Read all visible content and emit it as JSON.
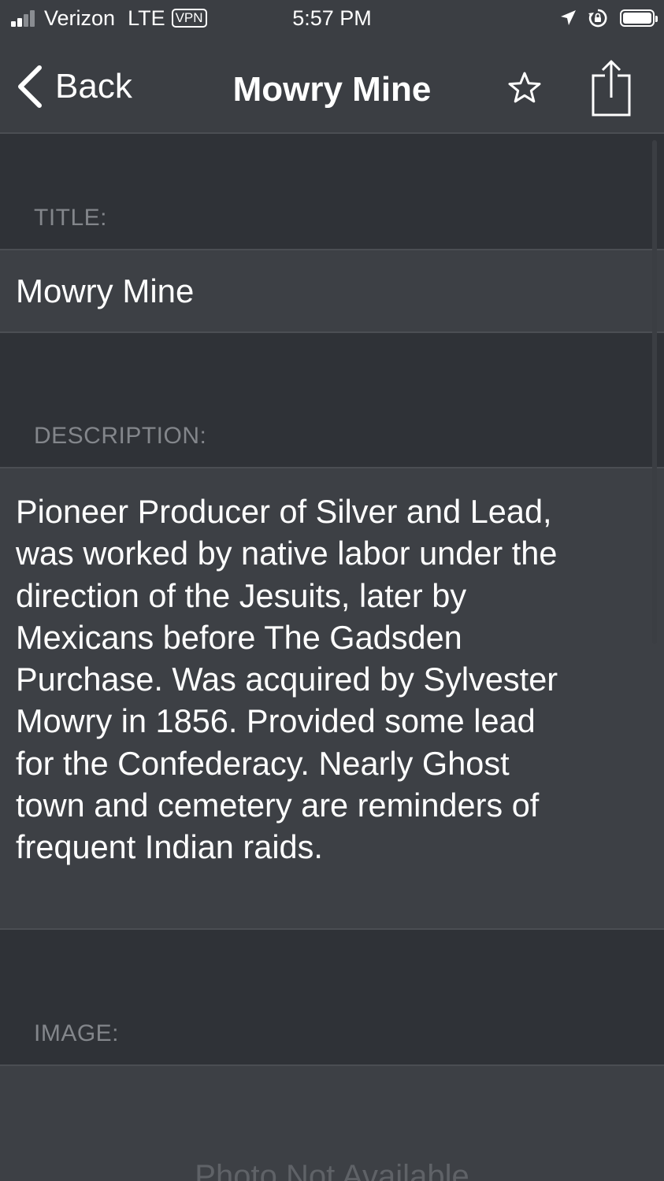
{
  "status_bar": {
    "carrier": "Verizon",
    "network": "LTE",
    "vpn": "VPN",
    "time": "5:57 PM"
  },
  "nav": {
    "back_label": "Back",
    "title": "Mowry Mine"
  },
  "sections": {
    "title_header": "TITLE:",
    "title_value": "Mowry Mine",
    "description_header": "DESCRIPTION:",
    "description_value": "Pioneer Producer of Silver and Lead, was worked by native labor under the direction of the Jesuits, later by Mexicans before The Gadsden Purchase. Was acquired by Sylvester Mowry in 1856. Provided some lead for the Confederacy. Nearly Ghost town and cemetery are reminders of frequent Indian raids.",
    "image_header": "IMAGE:",
    "image_placeholder": "Photo Not Available"
  },
  "icons": {
    "back": "chevron-left-icon",
    "favorite": "star-outline-icon",
    "share": "share-icon",
    "location": "location-arrow-icon",
    "orientation_lock": "orientation-lock-icon"
  },
  "colors": {
    "background": "#2f3237",
    "bar": "#3b3e43",
    "cell": "#3d4045",
    "separator": "#4b4e53",
    "header_text": "#83868b"
  }
}
